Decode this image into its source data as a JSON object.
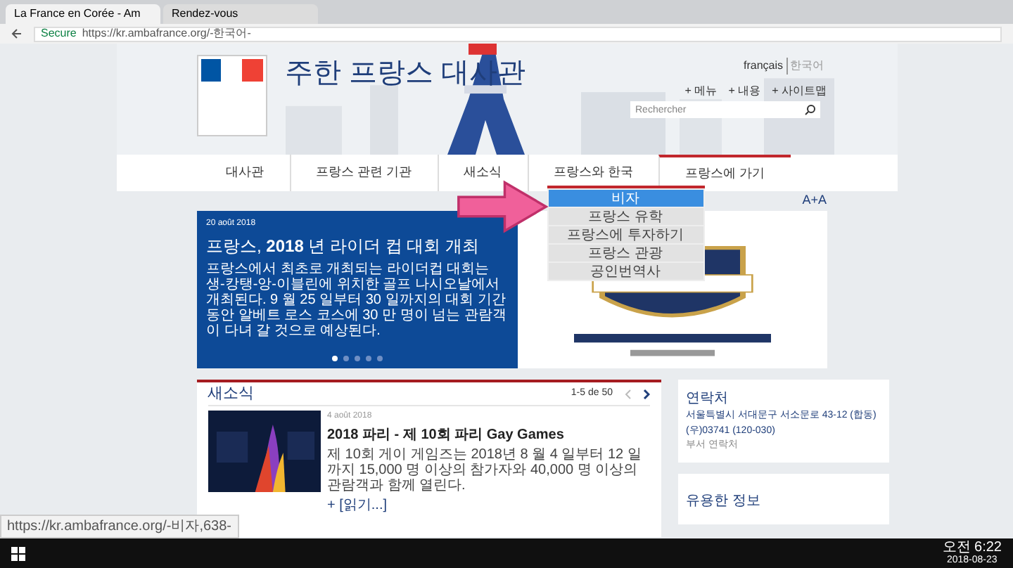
{
  "browser": {
    "tabs": [
      {
        "label": "La France en Corée - Am",
        "selected": true
      },
      {
        "label": "Rendez-vous",
        "selected": false
      }
    ],
    "security": "Secure",
    "url": "https://kr.ambafrance.org/-한국어-"
  },
  "header": {
    "title": "주한 프랑스 대사관",
    "languages": [
      {
        "label": "français",
        "selected": false
      },
      {
        "label": "한국어",
        "selected": true
      }
    ],
    "links": [
      "+ 메뉴",
      "+ 내용",
      "+ 사이트맵"
    ],
    "search": {
      "placeholder": "Rechercher"
    }
  },
  "nav": [
    {
      "label": "대사관",
      "selected": false
    },
    {
      "label": "프랑스 관련 기관",
      "selected": false
    },
    {
      "label": "새소식",
      "selected": false
    },
    {
      "label": "프랑스와 한국",
      "selected": false
    },
    {
      "label": "프랑스에 가기",
      "selected": true
    }
  ],
  "dropdown": [
    {
      "label": "비자",
      "selected": true
    },
    {
      "label": "프랑스 유학",
      "selected": false
    },
    {
      "label": "프랑스에 투자하기",
      "selected": false
    },
    {
      "label": "프랑스 관광",
      "selected": false
    },
    {
      "label": "공인번역사",
      "selected": false
    }
  ],
  "font_size_control": "A+A",
  "slider": {
    "date": "20 août 2018",
    "title": "프랑스, **2018** 년 라이더 컵 대회 개최",
    "text": "프랑스에서 최초로 개최되는 라이더컵 대회는 생-캉탱-앙-이블린에 위치한 골프 나시오날에서 개최된다. 9 월 25 일부터 30 일까지의 대회 기간 동안 알베트 로스 코스에 30 만 명이 넘는 관람객이 다녀 갈 것으로 예상된다.",
    "dots": [
      {
        "selected": true
      },
      {
        "selected": false
      },
      {
        "selected": false
      },
      {
        "selected": false
      },
      {
        "selected": false
      }
    ]
  },
  "news": {
    "title": "새소식",
    "count": "1-5 de 50",
    "item": {
      "date": "4 août 2018",
      "title": "2018 파리 - 제 10회 파리 Gay Games",
      "text": "제 10회 게이 게임즈는 2018년 8 월 4 일부터 12 일까지 15,000 명 이상의 참가자와 40,000 명 이상의 관람객과 함께 열린다.",
      "more": "+ [읽기...]"
    }
  },
  "contact": {
    "title": "연락처",
    "lines": [
      "서울특별시 서대문구 서소문로 43-12 (합동)",
      "(우)03741 (120-030)"
    ],
    "link": "부서 연락처"
  },
  "useful": {
    "title": "유용한 정보"
  },
  "status_url": "https://kr.ambafrance.org/-비자,638-",
  "taskbar": {
    "time": "오전 6:22",
    "date": "2018-08-23"
  }
}
